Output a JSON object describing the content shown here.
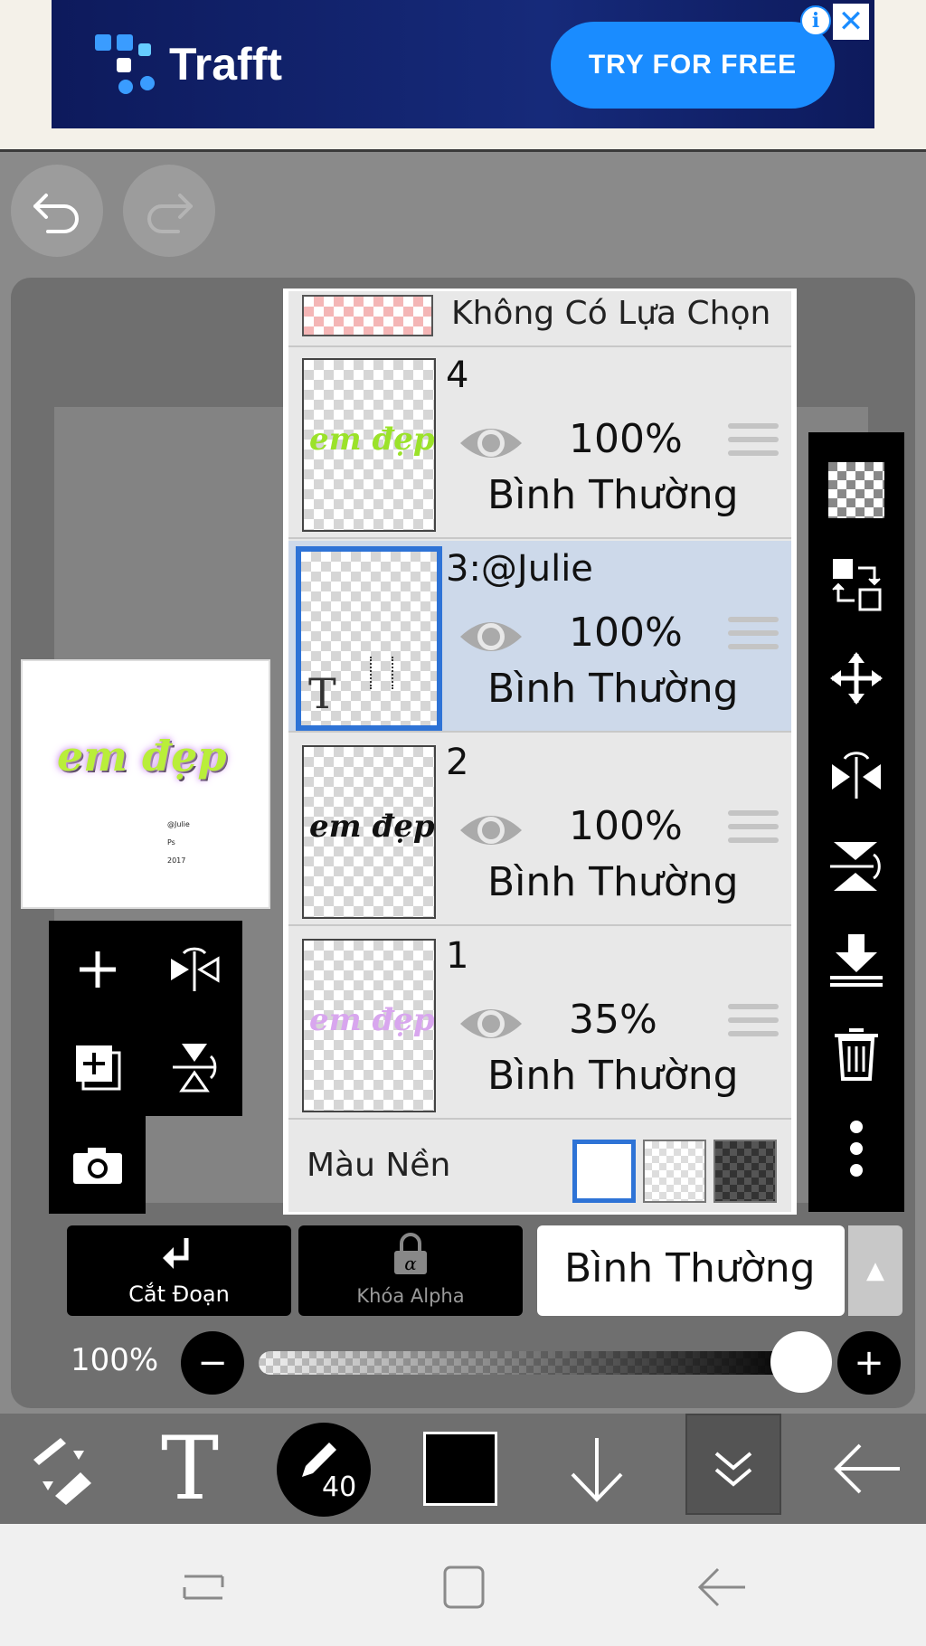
{
  "ad": {
    "brand": "Trafft",
    "cta": "TRY FOR FREE",
    "info_glyph": "i",
    "close_glyph": "✕"
  },
  "top_actions": {
    "undo_icon": "undo-icon",
    "redo_icon": "redo-icon"
  },
  "layers_panel": {
    "selection_label": "Không Có Lựa Chọn",
    "layers": [
      {
        "name": "4",
        "opacity": "100%",
        "blend": "Bình Thường",
        "thumb_text": "em đẹp",
        "thumb_color": "#9be22a",
        "selected": false
      },
      {
        "name": "3:@Julie",
        "opacity": "100%",
        "blend": "Bình Thường",
        "thumb_text": "T",
        "thumb_color": "#333333",
        "selected": true
      },
      {
        "name": "2",
        "opacity": "100%",
        "blend": "Bình Thường",
        "thumb_text": "em đẹp",
        "thumb_color": "#111111",
        "selected": false
      },
      {
        "name": "1",
        "opacity": "35%",
        "blend": "Bình Thường",
        "thumb_text": "em đẹp",
        "thumb_color": "#d8a6ee",
        "selected": false
      }
    ],
    "background_label": "Màu Nền"
  },
  "preview": {
    "title": "em đẹp",
    "lines": [
      "@Julie",
      "Ps",
      "2017"
    ]
  },
  "controls": {
    "clipping_label": "Cắt Đoạn",
    "alpha_lock_label": "Khóa Alpha",
    "blend_mode": "Bình Thường",
    "opacity_label": "100%",
    "opacity_value": 1.0
  },
  "toolbar": {
    "brush_size": "40",
    "color": "#000000",
    "text_tool_glyph": "T"
  },
  "colors": {
    "accent": "#2e73d6",
    "selected_row": "#cdd9ea",
    "ad_cta": "#1a8cff"
  }
}
